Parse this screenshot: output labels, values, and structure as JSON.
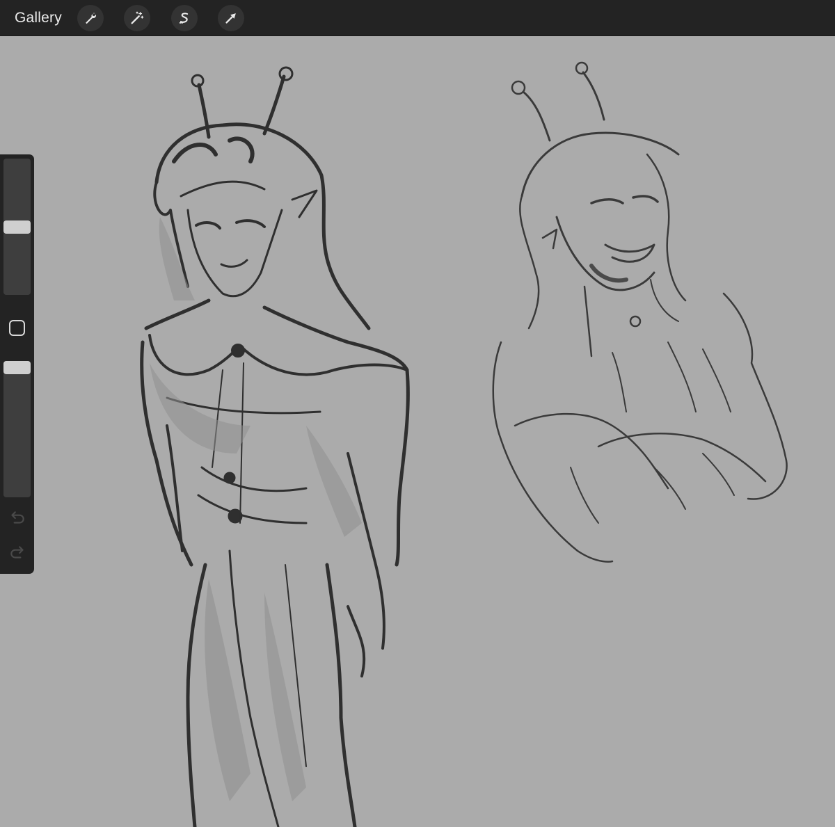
{
  "toolbar": {
    "gallery_label": "Gallery",
    "tools": [
      {
        "name": "wrench-icon"
      },
      {
        "name": "magic-wand-icon"
      },
      {
        "name": "selection-icon"
      },
      {
        "name": "transform-arrow-icon"
      }
    ]
  },
  "sidebar": {
    "brush_size": 0.5,
    "opacity": 1.0,
    "icons": [
      "undo-icon",
      "redo-icon"
    ]
  },
  "colors": {
    "toolbar_bg": "#232323",
    "canvas_bg": "#ababab",
    "ink": "#2e2e2e",
    "shade": "#8a8a8a"
  }
}
